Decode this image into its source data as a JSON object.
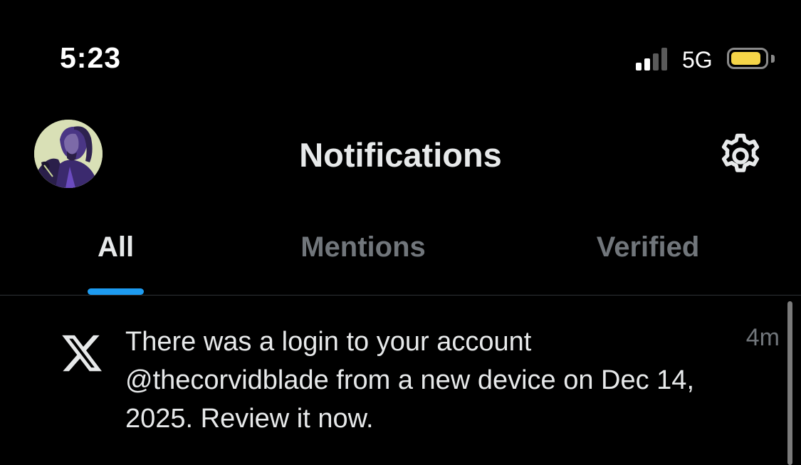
{
  "status_bar": {
    "time": "5:23",
    "network": "5G",
    "signal_bars_active": 2,
    "signal_bars_total": 4,
    "battery_color": "#f5d548",
    "battery_level": 0.9
  },
  "header": {
    "title": "Notifications",
    "avatar_icon": "profile-avatar",
    "settings_icon": "gear-icon"
  },
  "tabs": {
    "items": [
      {
        "label": "All",
        "active": true
      },
      {
        "label": "Mentions",
        "active": false
      },
      {
        "label": "Verified",
        "active": false
      }
    ],
    "active_color": "#e7e9ea",
    "inactive_color": "#71767b",
    "indicator_color": "#1d9bf0"
  },
  "notifications": [
    {
      "icon": "x-logo-icon",
      "text": "There was a login to your account @thecorvidblade from a new device on Dec 14, 2025. Review it now.",
      "time": "4m"
    }
  ]
}
